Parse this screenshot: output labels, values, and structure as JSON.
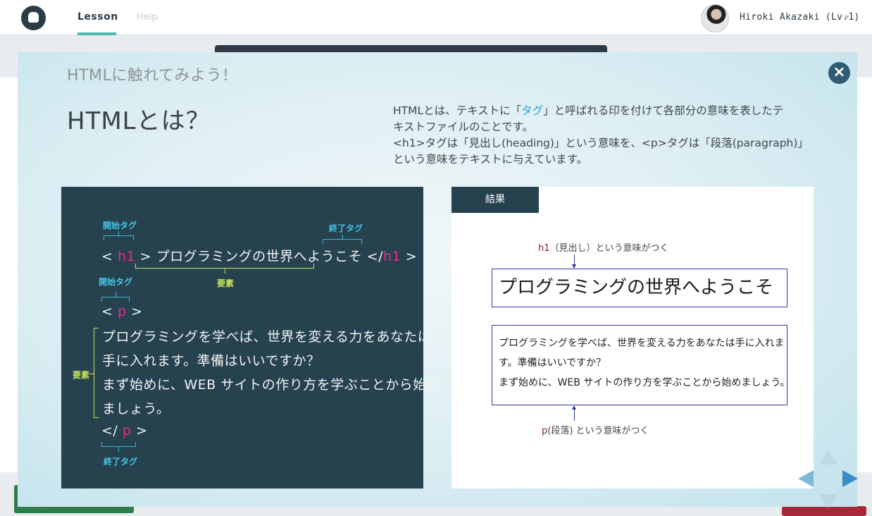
{
  "nav": {
    "lesson": "Lesson",
    "help": "Help",
    "user_name": "Hiroki Akazaki (Lv.1)"
  },
  "modal": {
    "lesson_title": "HTMLに触れてみよう！",
    "slide_title": "HTMLとは？",
    "description": {
      "line1_before": "HTMLとは、テキストに「",
      "line1_tag": "タグ",
      "line1_after": "」と呼ばれる印を付けて各部分の意味を表したテ",
      "line2": "キストファイルのことです。",
      "line3": "<h1>タグは「見出し(heading)」という意味を、<p>タグは「段落(paragraph)」",
      "line4": "という意味をテキストに与えています。"
    },
    "close_icon": "close-icon"
  },
  "code_panel": {
    "start_tag_label": "開始タグ",
    "end_tag_label": "終了タグ",
    "element_label": "要素",
    "h1_open_lt": "<",
    "h1_name": "h1",
    "h1_open_gt": ">",
    "h1_text": "プログラミングの世界へようこそ",
    "h1_close_lt": "</",
    "h1_close_gt": ">",
    "p_open_lt": "<",
    "p_name": "p",
    "p_open_gt": ">",
    "p_lines": [
      "プログラミングを学べば、世界を変える力をあなたは",
      "手に入れます。準備はいいですか？",
      "まず始めに、WEB サイトの作り方を学ぶことから始め",
      "ましょう。"
    ],
    "p_close_lt": "</",
    "p_close_gt": ">"
  },
  "result_panel": {
    "tab": "結果",
    "h1_note_tag": "h1",
    "h1_note_text": "（見出し）という意味がつく",
    "h1_text": "プログラミングの世界へようこそ",
    "p_lines": [
      "プログラミングを学べば、世界を変える力をあなたは手に入れま",
      "す。準備はいいですか？",
      "まず始めに、WEB サイトの作り方を学ぶことから始めましょう。"
    ],
    "p_note_tag": "p",
    "p_note_text": "(段落) という意味がつく"
  },
  "colors": {
    "code_bg": "#26424f",
    "tag_name": "#e62a86",
    "annotation_blue": "#46c3e6",
    "annotation_yellow": "#c9e55a",
    "highlight_tag": "#1aa3d6",
    "result_border": "#2f3a8f"
  },
  "icons": [
    "logo-icon",
    "close-icon",
    "chevron-down-icon",
    "arrow-left-icon",
    "arrow-right-icon"
  ]
}
